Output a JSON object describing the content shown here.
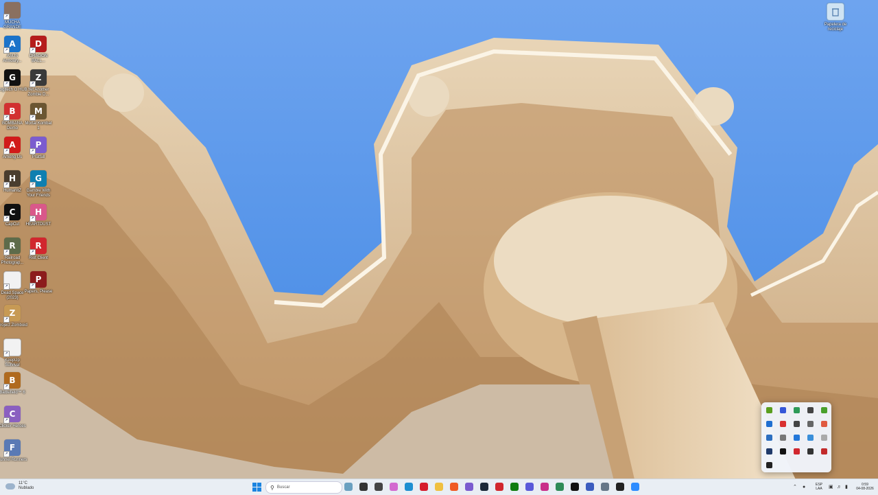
{
  "desktop": {
    "icons": [
      {
        "label": "MUCHA GRANDE",
        "color": "#8a7060",
        "glyph": "",
        "col": 0,
        "row": 0
      },
      {
        "label": "ASUS Armoury...",
        "color": "#1c73c9",
        "glyph": "A",
        "col": 0,
        "row": 1
      },
      {
        "label": "DRAGON BALL...",
        "color": "#b51c1c",
        "glyph": "D",
        "col": 1,
        "row": 1
      },
      {
        "label": "Logitech G HUB",
        "color": "#111111",
        "glyph": "G",
        "col": 0,
        "row": 2
      },
      {
        "label": "Yet Another Zombie D...",
        "color": "#3a3a3a",
        "glyph": "Z",
        "col": 1,
        "row": 2
      },
      {
        "label": "BOMBANA Demo",
        "color": "#d23030",
        "glyph": "B",
        "col": 0,
        "row": 3
      },
      {
        "label": "Mortal Kombat 1",
        "color": "#6b5632",
        "glyph": "M",
        "col": 1,
        "row": 3
      },
      {
        "label": "Among Us",
        "color": "#d11a1a",
        "glyph": "A",
        "col": 0,
        "row": 4
      },
      {
        "label": "Pratfall",
        "color": "#7b5ccf",
        "glyph": "P",
        "col": 1,
        "row": 4
      },
      {
        "label": "HumanitZ",
        "color": "#4a3d2e",
        "glyph": "H",
        "col": 0,
        "row": 5
      },
      {
        "label": "Gamble With Your Friends",
        "color": "#0e7fb0",
        "glyph": "G",
        "col": 1,
        "row": 5
      },
      {
        "label": "CapCut",
        "color": "#101010",
        "glyph": "C",
        "col": 0,
        "row": 6
      },
      {
        "label": "HEARTDUST",
        "color": "#d9588a",
        "glyph": "H",
        "col": 1,
        "row": 6
      },
      {
        "label": "Railroad Photograp...",
        "color": "#5d6b4a",
        "glyph": "R",
        "col": 0,
        "row": 7
      },
      {
        "label": "Riot Client",
        "color": "#d1272e",
        "glyph": "R",
        "col": 1,
        "row": 7
      },
      {
        "label": "Dead Space (2023)",
        "color": "#f2f2f2",
        "glyph": "",
        "col": 0,
        "row": 8
      },
      {
        "label": "Papers, Please",
        "color": "#8c1c1c",
        "glyph": "P",
        "col": 1,
        "row": 8
      },
      {
        "label": "Project Zomboid",
        "color": "#c79a55",
        "glyph": "Z",
        "col": 0,
        "row": 9
      },
      {
        "label": "KeepUp Survival",
        "color": "#f2f2f2",
        "glyph": "",
        "col": 0,
        "row": 10
      },
      {
        "label": "Battlefield™ 6",
        "color": "#b06a1e",
        "glyph": "B",
        "col": 0,
        "row": 11
      },
      {
        "label": "Clicker Heroes",
        "color": "#8a5fc0",
        "glyph": "C",
        "col": 0,
        "row": 12
      },
      {
        "label": "Funnel Runners",
        "color": "#5a7ab5",
        "glyph": "F",
        "col": 0,
        "row": 13
      }
    ],
    "recycle_bin_label": "Papelera de reciclaje"
  },
  "tray_popup": {
    "items": [
      {
        "name": "nvidia-icon",
        "color": "#5a9e1e"
      },
      {
        "name": "app-blue-icon",
        "color": "#3557d8"
      },
      {
        "name": "app-green-icon",
        "color": "#2e9a57"
      },
      {
        "name": "app-dark-icon",
        "color": "#444444"
      },
      {
        "name": "app-green2-icon",
        "color": "#4aa02c"
      },
      {
        "name": "app-square-icon",
        "color": "#1f6fd1"
      },
      {
        "name": "app-red-icon",
        "color": "#d93030"
      },
      {
        "name": "steam-icon",
        "color": "#444444"
      },
      {
        "name": "app-grey-icon",
        "color": "#666666"
      },
      {
        "name": "app-orange-icon",
        "color": "#e05a40"
      },
      {
        "name": "app-blue2-icon",
        "color": "#2d6fc0"
      },
      {
        "name": "usb-icon",
        "color": "#777777"
      },
      {
        "name": "bluetooth-icon",
        "color": "#2477d9"
      },
      {
        "name": "onedrive-icon",
        "color": "#3a8fd9"
      },
      {
        "name": "app-light-icon",
        "color": "#aaaaaa"
      },
      {
        "name": "app-navy-icon",
        "color": "#203a6a"
      },
      {
        "name": "logitech-icon",
        "color": "#111111"
      },
      {
        "name": "riot-icon",
        "color": "#d1272e"
      },
      {
        "name": "app-dark2-icon",
        "color": "#333333"
      },
      {
        "name": "microphone-icon",
        "color": "#c22a2a"
      },
      {
        "name": "app-black-icon",
        "color": "#222222"
      }
    ]
  },
  "taskbar": {
    "weather": {
      "temp": "11°C",
      "condition": "Nublado"
    },
    "search_placeholder": "Buscar",
    "apps": [
      {
        "name": "taskbar-widget-icon",
        "color": "#6aa0c0"
      },
      {
        "name": "taskbar-task-view-icon",
        "color": "#333333"
      },
      {
        "name": "taskbar-app1-icon",
        "color": "#444444"
      },
      {
        "name": "taskbar-copilot-icon",
        "color": "#d36ad0"
      },
      {
        "name": "taskbar-edge-icon",
        "color": "#1e8fd1"
      },
      {
        "name": "taskbar-opera-icon",
        "color": "#d61c2c"
      },
      {
        "name": "taskbar-explorer-icon",
        "color": "#f0c040"
      },
      {
        "name": "taskbar-brave-icon",
        "color": "#f05a24"
      },
      {
        "name": "taskbar-discord-icon",
        "color": "#7b5ccf"
      },
      {
        "name": "taskbar-steam-icon",
        "color": "#1b2838"
      },
      {
        "name": "taskbar-app2-icon",
        "color": "#d1272e"
      },
      {
        "name": "taskbar-xbox-icon",
        "color": "#107c10"
      },
      {
        "name": "taskbar-app3-icon",
        "color": "#5a5ad9"
      },
      {
        "name": "taskbar-app4-icon",
        "color": "#c92f8a"
      },
      {
        "name": "taskbar-app5-icon",
        "color": "#2e8b57"
      },
      {
        "name": "taskbar-app6-icon",
        "color": "#111111"
      },
      {
        "name": "taskbar-app7-icon",
        "color": "#3c5dbf"
      },
      {
        "name": "taskbar-app8-icon",
        "color": "#667788"
      },
      {
        "name": "taskbar-app9-icon",
        "color": "#222222"
      },
      {
        "name": "taskbar-zoom-icon",
        "color": "#2d8cff"
      }
    ],
    "language": "ESP",
    "layout": "LAA",
    "time": "0:59",
    "date": "04-08-2026"
  }
}
